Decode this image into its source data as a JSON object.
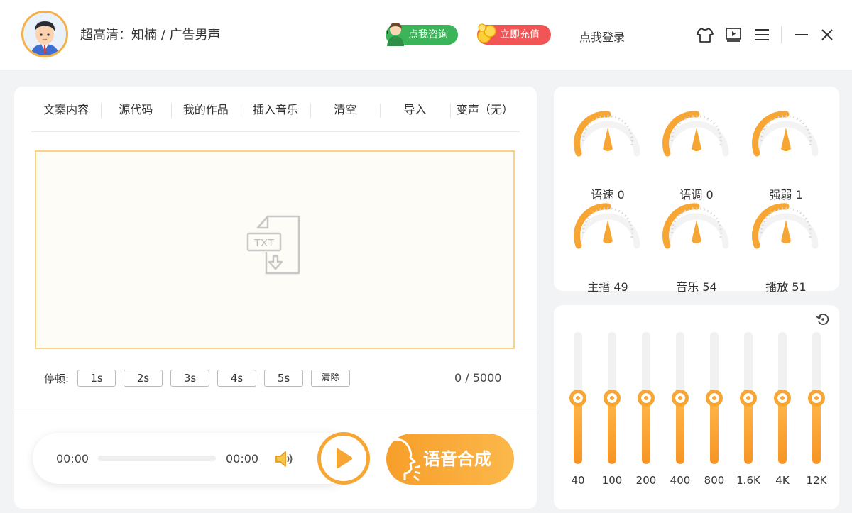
{
  "header": {
    "title": "超高清：知楠 / 广告男声",
    "consult_label": "点我咨询",
    "recharge_label": "立即充值",
    "login_label": "点我登录",
    "icons": [
      "skin-icon",
      "video-icon",
      "menu-icon",
      "minimize-icon",
      "close-icon"
    ]
  },
  "tabs": [
    {
      "label": "文案内容"
    },
    {
      "label": "源代码"
    },
    {
      "label": "我的作品"
    },
    {
      "label": "插入音乐"
    },
    {
      "label": "清空"
    },
    {
      "label": "导入"
    },
    {
      "label": "变声（无）"
    }
  ],
  "editor": {
    "icon_text": "TXT"
  },
  "pause": {
    "label": "停顿:",
    "buttons": [
      "1s",
      "2s",
      "3s",
      "4s",
      "5s"
    ],
    "clear_label": "清除",
    "char_count": "0 / 5000"
  },
  "player": {
    "current_time": "00:00",
    "total_time": "00:00",
    "progress": 0
  },
  "synth_label": "语音合成",
  "knobs": [
    {
      "label": "语速 0"
    },
    {
      "label": "语调 0"
    },
    {
      "label": "强弱 1"
    },
    {
      "label": "主播 49"
    },
    {
      "label": "音乐 54"
    },
    {
      "label": "播放 51"
    }
  ],
  "equalizer": {
    "bands": [
      {
        "label": "40",
        "level": 0.5
      },
      {
        "label": "100",
        "level": 0.5
      },
      {
        "label": "200",
        "level": 0.5
      },
      {
        "label": "400",
        "level": 0.5
      },
      {
        "label": "800",
        "level": 0.5
      },
      {
        "label": "1.6K",
        "level": 0.5
      },
      {
        "label": "4K",
        "level": 0.5
      },
      {
        "label": "12K",
        "level": 0.5
      }
    ]
  },
  "colors": {
    "accent": "#f7a533",
    "consult_green": "#3cb45a",
    "recharge_red": "#f25555",
    "editor_border": "#f8d383"
  }
}
